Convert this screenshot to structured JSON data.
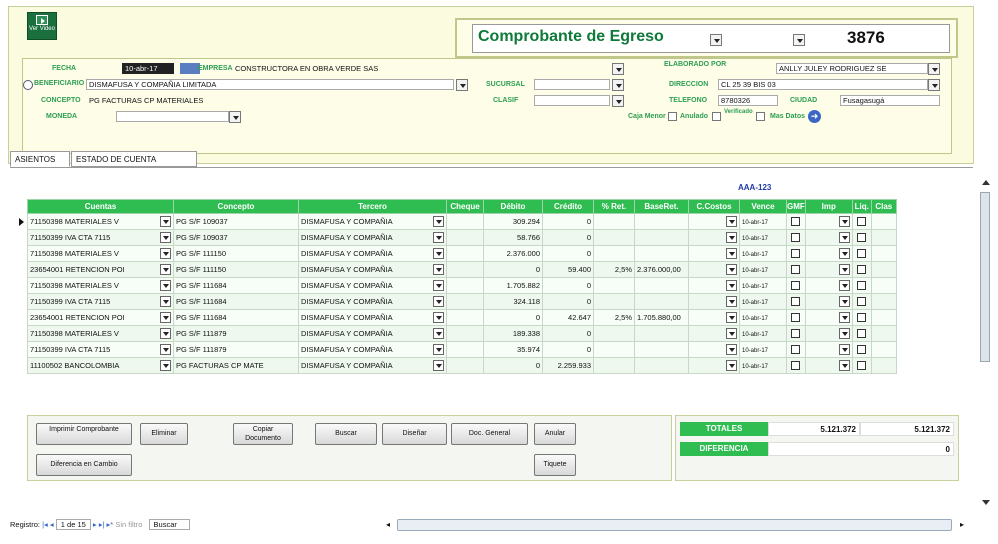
{
  "header": {
    "video_label": "Ver Video",
    "title": "Comprobante de Egreso",
    "number": "3876"
  },
  "form": {
    "fecha_label": "FECHA",
    "fecha_value": "10-abr-17",
    "empresa_label": "EMPRESA",
    "empresa_value": "CONSTRUCTORA EN OBRA VERDE SAS",
    "elaborado_label": "ELABORADO POR",
    "elaborado_value": "ANLLY JULEY RODRIGUEZ SE",
    "beneficiario_label": "BENEFICIARIO",
    "beneficiario_value": "DISMAFUSA Y COMPAÑIA LIMITADA",
    "sucursal_label": "SUCURSAL",
    "direccion_label": "DIRECCION",
    "direccion_value": "CL 25 39 BIS 03",
    "concepto_label": "CONCEPTO",
    "concepto_value": "PG FACTURAS CP MATERIALES",
    "clasif_label": "CLASIF",
    "telefono_label": "TELEFONO",
    "telefono_value": "8780326",
    "ciudad_label": "CIUDAD",
    "ciudad_value": "Fusagasugá",
    "moneda_label": "MONEDA",
    "caja_menor_label": "Caja Menor",
    "anulado_label": "Anulado",
    "verificado_label": "Verificado",
    "mas_datos_label": "Mas Datos"
  },
  "tabs": [
    "ASIENTOS",
    "ESTADO DE CUENTA"
  ],
  "grid": {
    "code_label": "AAA-123",
    "columns": [
      "Cuentas",
      "Concepto",
      "Tercero",
      "Cheque",
      "Débito",
      "Crédito",
      "% Ret.",
      "BaseRet.",
      "C.Costos",
      "Vence",
      "GMF",
      "Imp",
      "Liq.",
      "Clas"
    ],
    "rows": [
      {
        "cuenta": "71150398 MATERIALES V",
        "concepto": "PG S/F 109037",
        "tercero": "DISMAFUSA Y COMPAÑIA",
        "cheque": "",
        "debito": "309.294",
        "credito": "0",
        "ret": "",
        "base": "",
        "vence": "10-abr-17"
      },
      {
        "cuenta": "71150399 IVA CTA 7115",
        "concepto": "PG S/F 109037",
        "tercero": "DISMAFUSA Y COMPAÑIA",
        "cheque": "",
        "debito": "58.766",
        "credito": "0",
        "ret": "",
        "base": "",
        "vence": "10-abr-17"
      },
      {
        "cuenta": "71150398 MATERIALES V",
        "concepto": "PG S/F 111150",
        "tercero": "DISMAFUSA Y COMPAÑIA",
        "cheque": "",
        "debito": "2.376.000",
        "credito": "0",
        "ret": "",
        "base": "",
        "vence": "10-abr-17"
      },
      {
        "cuenta": "23654001 RETENCION POI",
        "concepto": "PG S/F 111150",
        "tercero": "DISMAFUSA Y COMPAÑIA",
        "cheque": "",
        "debito": "0",
        "credito": "59.400",
        "ret": "2,5%",
        "base": "2.376.000,00",
        "vence": "10-abr-17"
      },
      {
        "cuenta": "71150398 MATERIALES V",
        "concepto": "PG S/F 111684",
        "tercero": "DISMAFUSA Y COMPAÑIA",
        "cheque": "",
        "debito": "1.705.882",
        "credito": "0",
        "ret": "",
        "base": "",
        "vence": "10-abr-17"
      },
      {
        "cuenta": "71150399 IVA CTA 7115",
        "concepto": "PG S/F 111684",
        "tercero": "DISMAFUSA Y COMPAÑIA",
        "cheque": "",
        "debito": "324.118",
        "credito": "0",
        "ret": "",
        "base": "",
        "vence": "10-abr-17"
      },
      {
        "cuenta": "23654001 RETENCION POI",
        "concepto": "PG S/F 111684",
        "tercero": "DISMAFUSA Y COMPAÑIA",
        "cheque": "",
        "debito": "0",
        "credito": "42.647",
        "ret": "2,5%",
        "base": "1.705.880,00",
        "vence": "10-abr-17"
      },
      {
        "cuenta": "71150398 MATERIALES V",
        "concepto": "PG S/F 111879",
        "tercero": "DISMAFUSA Y COMPAÑIA",
        "cheque": "",
        "debito": "189.338",
        "credito": "0",
        "ret": "",
        "base": "",
        "vence": "10-abr-17"
      },
      {
        "cuenta": "71150399 IVA CTA 7115",
        "concepto": "PG S/F 111879",
        "tercero": "DISMAFUSA Y COMPAÑIA",
        "cheque": "",
        "debito": "35.974",
        "credito": "0",
        "ret": "",
        "base": "",
        "vence": "10-abr-17"
      },
      {
        "cuenta": "11100502 BANCOLOMBIA",
        "concepto": "PG FACTURAS CP MATE",
        "tercero": "DISMAFUSA Y COMPAÑIA",
        "cheque": "",
        "debito": "0",
        "credito": "2.259.933",
        "ret": "",
        "base": "",
        "vence": "10-abr-17"
      }
    ]
  },
  "buttons": {
    "imprimir": "Imprimir Comprobante",
    "eliminar": "Eliminar",
    "copiar": "Copiar Documento",
    "buscar": "Buscar",
    "disenar": "Diseñar",
    "doc_general": "Doc. General",
    "anular": "Anular",
    "tiquete": "Tiquete",
    "diferencia_cambio": "Diferencia en Cambio"
  },
  "totals": {
    "totales_label": "TOTALES",
    "debito_total": "5.121.372",
    "credito_total": "5.121.372",
    "diferencia_label": "DIFERENCIA",
    "diferencia_value": "0"
  },
  "status": {
    "registro_label": "Registro:",
    "record_text": "1 de 15",
    "filter_label": "Sin filtro",
    "search_label": "Buscar"
  },
  "colors": {
    "accent_green": "#2fbd52",
    "title_green": "#0e7a3a",
    "frame_bg": "#fbfcdf"
  }
}
